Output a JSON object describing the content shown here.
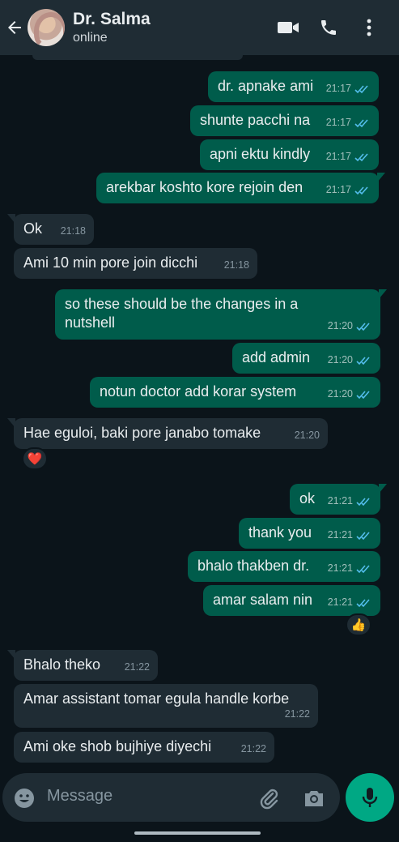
{
  "header": {
    "title": "Dr. Salma",
    "status": "online"
  },
  "messages": [
    {
      "dir": "out",
      "text": "dr. apnake ami",
      "time": "21:17"
    },
    {
      "dir": "out",
      "text": "shunte pacchi na",
      "time": "21:17"
    },
    {
      "dir": "out",
      "text": "apni ektu kindly",
      "time": "21:17"
    },
    {
      "dir": "out",
      "text": "arekbar koshto kore rejoin den",
      "time": "21:17"
    },
    {
      "dir": "in",
      "text": "Ok",
      "time": "21:18"
    },
    {
      "dir": "in",
      "text": "Ami 10 min pore join dicchi",
      "time": "21:18"
    },
    {
      "dir": "out",
      "text": "so these should be the changes in a nutshell",
      "time": "21:20"
    },
    {
      "dir": "out",
      "text": "add admin",
      "time": "21:20"
    },
    {
      "dir": "out",
      "text": "notun doctor add korar system",
      "time": "21:20"
    },
    {
      "dir": "in",
      "text": "Hae eguloi, baki pore janabo tomake",
      "time": "21:20",
      "reaction": "❤️"
    },
    {
      "dir": "out",
      "text": "ok",
      "time": "21:21"
    },
    {
      "dir": "out",
      "text": "thank you",
      "time": "21:21"
    },
    {
      "dir": "out",
      "text": "bhalo thakben dr.",
      "time": "21:21"
    },
    {
      "dir": "out",
      "text": "amar salam nin",
      "time": "21:21",
      "reaction": "👍"
    },
    {
      "dir": "in",
      "text": "Bhalo theko",
      "time": "21:22"
    },
    {
      "dir": "in",
      "text": "Amar assistant tomar egula handle korbe",
      "time": "21:22"
    },
    {
      "dir": "in",
      "text": "Ami oke shob bujhiye diyechi",
      "time": "21:22"
    }
  ],
  "composer": {
    "placeholder": "Message"
  },
  "colors": {
    "background": "#0b141a",
    "outgoing_bubble": "#005c4b",
    "incoming_bubble": "#1f2c34",
    "accent": "#00a884",
    "read_ticks": "#53bdeb"
  }
}
